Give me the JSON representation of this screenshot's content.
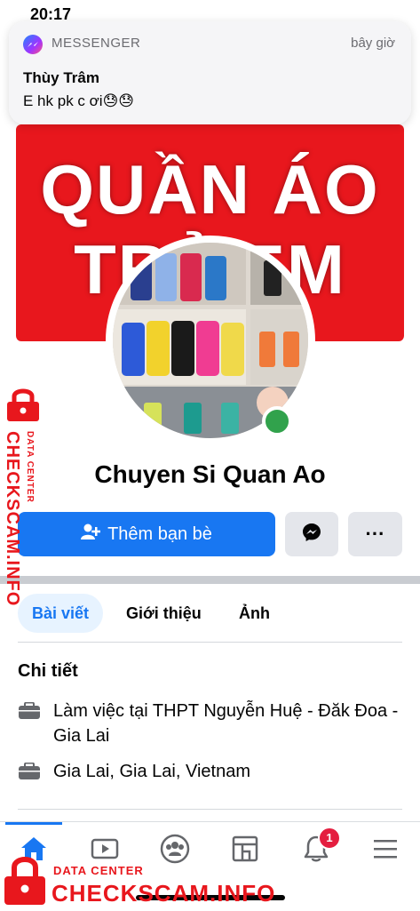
{
  "status_bar": {
    "time": "20:17"
  },
  "notification": {
    "app_name": "MESSENGER",
    "time": "bây giờ",
    "sender": "Thùy Trâm",
    "message": "E hk pk c ơi😓😓"
  },
  "cover": {
    "text_line1": "QUẦN ÁO",
    "text_line2": "TRẺ EM",
    "bg_color": "#e8171d"
  },
  "profile": {
    "name": "Chuyen Si Quan Ao"
  },
  "actions": {
    "add_friend_label": "Thêm bạn bè",
    "more_label": "···"
  },
  "tabs": [
    {
      "label": "Bài viết",
      "active": true
    },
    {
      "label": "Giới thiệu",
      "active": false
    },
    {
      "label": "Ảnh",
      "active": false
    }
  ],
  "details": {
    "title": "Chi tiết",
    "items": [
      {
        "icon": "briefcase-icon",
        "text": "Làm việc tại THPT Nguyễn Huệ - Đăk Đoa - Gia Lai"
      },
      {
        "icon": "briefcase-icon",
        "text": "Gia Lai, Gia Lai, Vietnam"
      }
    ]
  },
  "bottom_nav": {
    "items": [
      "home-icon",
      "video-icon",
      "groups-icon",
      "marketplace-icon",
      "notifications-icon",
      "menu-icon"
    ],
    "notification_count": "1"
  },
  "watermark": {
    "line1": "DATA CENTER",
    "line2": "CHECKSCAM.INFO"
  },
  "colors": {
    "primary": "#1877f2",
    "online": "#31a24c",
    "badge": "#e41e3f",
    "watermark": "#e8171d"
  }
}
